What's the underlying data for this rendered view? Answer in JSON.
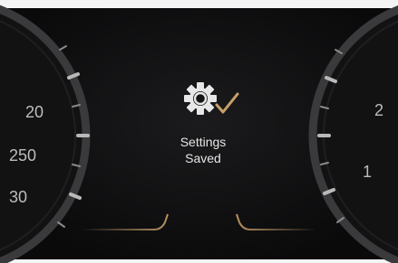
{
  "notification": {
    "line1": "Settings",
    "line2": "Saved",
    "icon": "gear-check-icon"
  },
  "gauges": {
    "left_tick_labels": [
      "20",
      "250",
      "30"
    ],
    "right_tick_labels": [
      "2",
      "1"
    ]
  },
  "colors": {
    "background": "#0b0b0c",
    "accent": "#c9a06a",
    "text": "#e6e6e6"
  }
}
